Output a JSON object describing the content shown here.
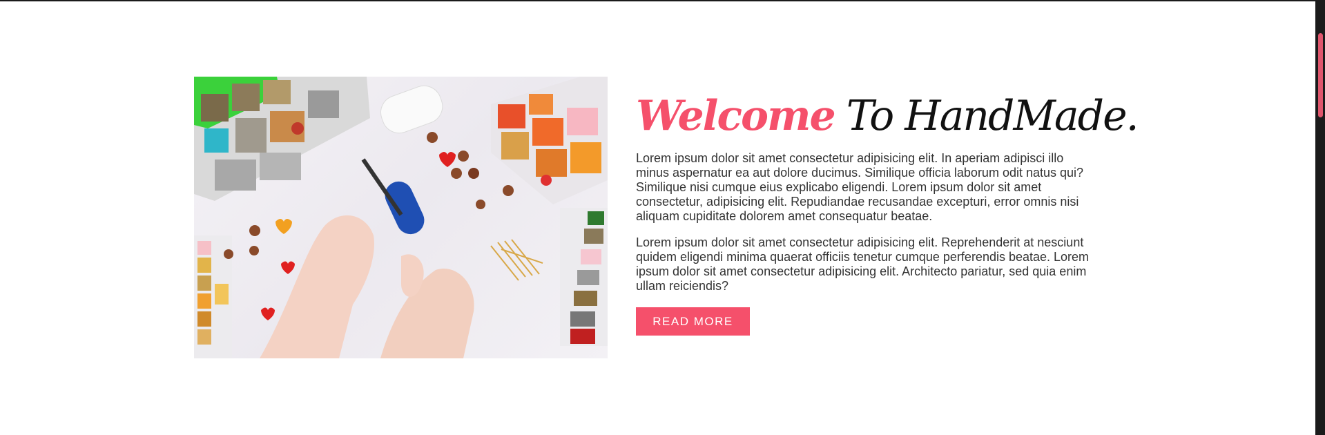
{
  "about": {
    "heading_accent": "Welcome",
    "heading_rest": "To HandMade.",
    "paragraphs": [
      "Lorem ipsum dolor sit amet consectetur adipisicing elit. In aperiam adipisci illo minus aspernatur ea aut dolore ducimus. Similique officia laborum odit natus qui? Similique nisi cumque eius explicabo eligendi. Lorem ipsum dolor sit amet consectetur, adipisicing elit. Repudiandae recusandae excepturi, error omnis nisi aliquam cupiditate dolorem amet consequatur beatae.",
      "Lorem ipsum dolor sit amet consectetur adipisicing elit. Reprehenderit at nesciunt quidem eligendi minima quaerat officiis tenetur cumque perferendis beatae. Lorem ipsum dolor sit amet consectetur adipisicing elit. Architecto pariatur, sed quia enim ullam reiciendis?"
    ],
    "button_label": "Read more"
  },
  "colors": {
    "accent": "#f5506b",
    "text": "#333333",
    "heading": "#111111",
    "background": "#ffffff"
  }
}
